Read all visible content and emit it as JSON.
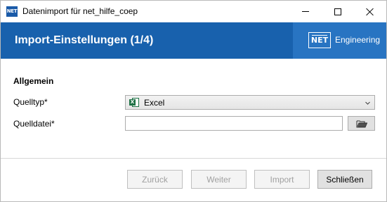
{
  "window": {
    "app_icon_text": "NET",
    "title": "Datenimport für net_hilfe_coep"
  },
  "banner": {
    "title": "Import-Einstellungen (1/4)",
    "brand_logo": "NET",
    "brand_text": "Engineering",
    "color": "#1861ad",
    "brand_color": "#2874c2"
  },
  "form": {
    "section_title": "Allgemein",
    "source_type_label": "Quelltyp*",
    "source_type_value": "Excel",
    "source_type_icon": "excel-icon",
    "source_file_label": "Quelldatei*",
    "source_file_value": "",
    "browse_icon": "folder-open-icon"
  },
  "footer": {
    "back_label": "Zurück",
    "next_label": "Weiter",
    "import_label": "Import",
    "close_label": "Schließen"
  }
}
